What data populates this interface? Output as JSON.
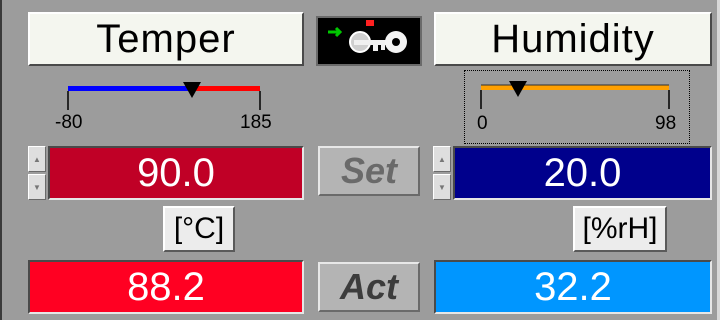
{
  "temperature": {
    "title": "Temper",
    "scale_min_label": "-80",
    "scale_max_label": "185",
    "setpoint": "90.0",
    "unit": "[°C]",
    "actual": "88.2"
  },
  "humidity": {
    "title": "Humidity",
    "scale_min_label": "0",
    "scale_max_label": "98",
    "setpoint": "20.0",
    "unit": "[%rH]",
    "actual": "32.2"
  },
  "center": {
    "key_icon": "key-switch-icon",
    "set_label": "Set",
    "act_label": "Act"
  },
  "colors": {
    "temp_set_bg": "#c00026",
    "temp_act_bg": "#ff0022",
    "hum_set_bg": "#00008c",
    "hum_act_bg": "#0096ff",
    "temp_scale_low": "#0000ff",
    "temp_scale_high": "#ff0000",
    "hum_scale": "#ffa000"
  }
}
